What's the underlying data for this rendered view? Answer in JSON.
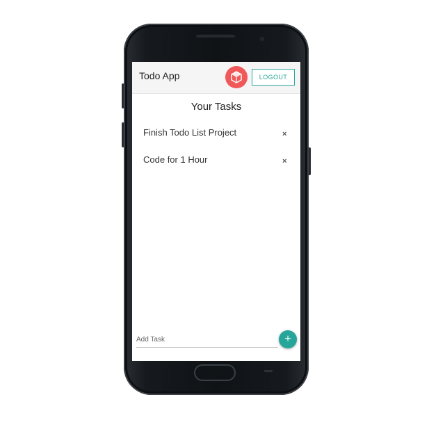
{
  "app": {
    "title": "Todo App",
    "logout_label": "LOGOUT",
    "avatar_icon": "user-avatar-icon"
  },
  "main": {
    "heading": "Your Tasks",
    "tasks": [
      {
        "text": "Finish Todo List Project",
        "remove_label": "×"
      },
      {
        "text": "Code for 1 Hour",
        "remove_label": "×"
      }
    ]
  },
  "add_task": {
    "placeholder": "Add Task",
    "value": "",
    "add_label": "+"
  },
  "colors": {
    "accent": "#26a69a",
    "avatar": "#f0585a",
    "appbar": "#f5f5f5"
  }
}
